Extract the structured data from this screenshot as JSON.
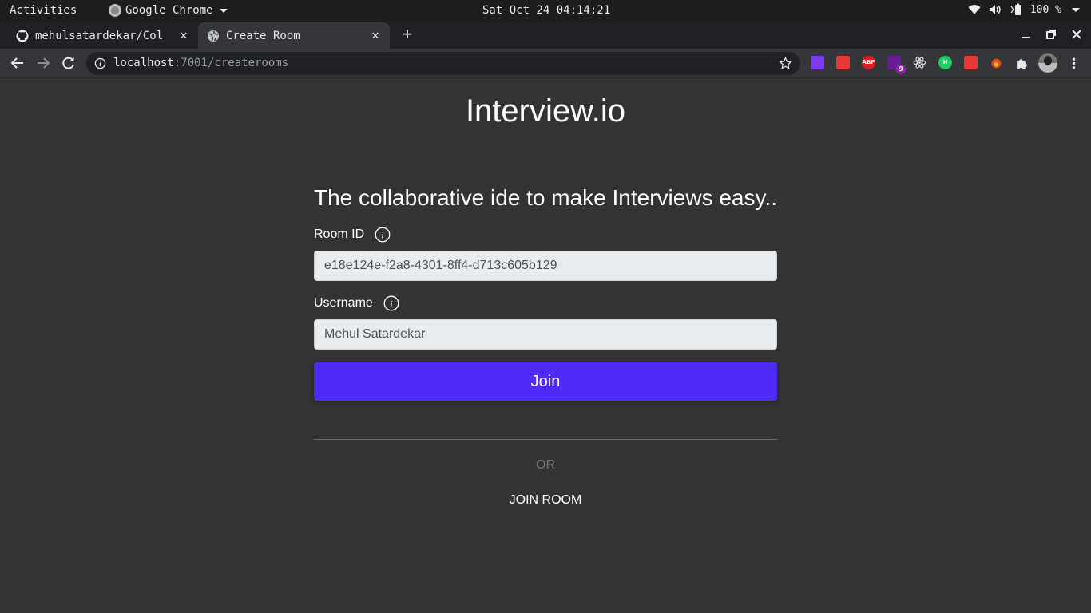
{
  "system": {
    "activities": "Activities",
    "app_name": "Google Chrome",
    "clock": "Sat Oct 24 04:14:21",
    "battery": "100 %"
  },
  "tabs": [
    {
      "title": "mehulsatardekar/Col",
      "icon": "github-icon"
    },
    {
      "title": "Create Room",
      "icon": "globe-icon"
    }
  ],
  "toolbar": {
    "url_host": "localhost",
    "url_rest": ":7001/createrooms",
    "extensions": [
      {
        "name": "extension-purple-icon",
        "color": "#7c3aed",
        "text": ""
      },
      {
        "name": "extension-book-icon",
        "color": "#e53935",
        "text": ""
      },
      {
        "name": "adblock-icon",
        "color": "#e11b22",
        "text": "ABP"
      },
      {
        "name": "extension-badge-icon",
        "color": "#6a1b9a",
        "text": "",
        "badge": "9"
      },
      {
        "name": "react-devtools-icon",
        "color": "#35363a",
        "text": ""
      },
      {
        "name": "extension-h-icon",
        "color": "#1fcc60",
        "text": "H"
      },
      {
        "name": "extension-red-icon",
        "color": "#e53935",
        "text": ""
      },
      {
        "name": "extension-fire-icon",
        "color": "#35363a",
        "text": ""
      }
    ]
  },
  "page": {
    "brand": "Interview.io",
    "tagline": "The collaborative ide to make Interviews easy..",
    "room_id_label": "Room ID",
    "room_id_value": "e18e124e-f2a8-4301-8ff4-d713c605b129",
    "username_label": "Username",
    "username_value": "Mehul Satardekar",
    "join_label": "Join",
    "or_label": "OR",
    "join_room_label": "JOIN ROOM",
    "accent_color": "#4f2af8"
  }
}
